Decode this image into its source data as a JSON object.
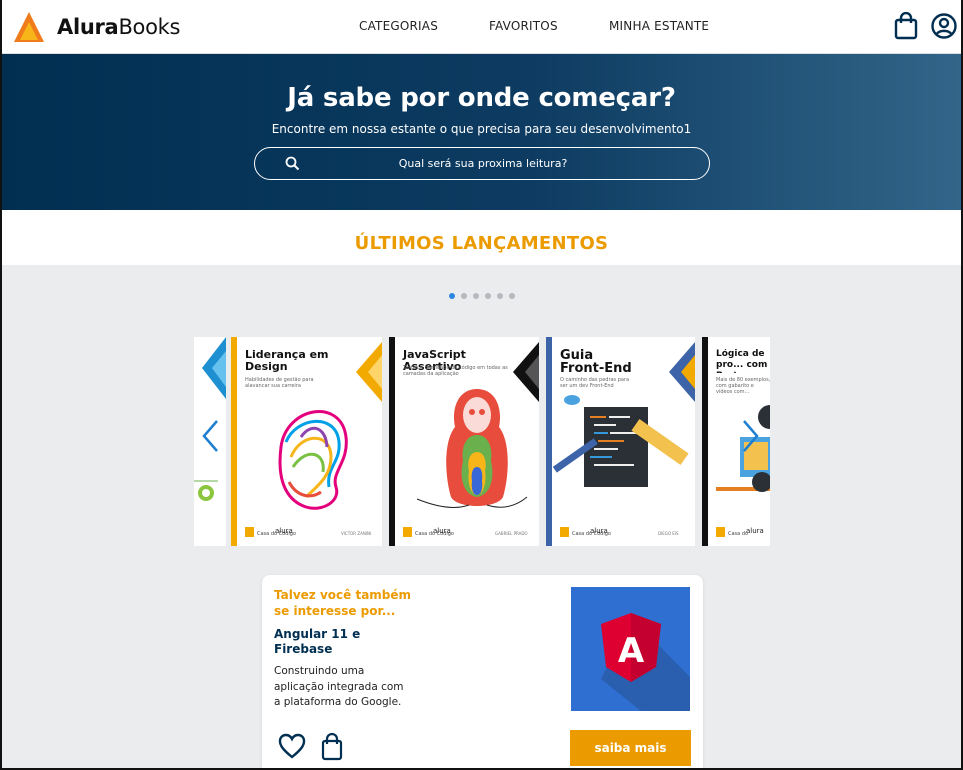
{
  "brand": {
    "name_bold": "Alura",
    "name_regular": "Books",
    "accent": "#eb9b00",
    "dark": "#002f52"
  },
  "nav": {
    "items": [
      "CATEGORIAS",
      "FAVORITOS",
      "MINHA ESTANTE"
    ]
  },
  "header_icons": [
    "shopping-bag-icon",
    "user-icon"
  ],
  "hero": {
    "title": "Já sabe por onde começar?",
    "subtitle": "Encontre em nossa estante o que precisa para seu desenvolvimento1",
    "search_placeholder": "Qual será sua proxima leitura?"
  },
  "section": {
    "title": "ÚLTIMOS LANÇAMENTOS"
  },
  "carousel": {
    "active_index": 0,
    "dot_count": 6,
    "books": [
      {
        "title": "Liderança em Design",
        "subtitle": "Habilidades de gestão para alavancar sua carreira",
        "publisher": "alura"
      },
      {
        "title": "JavaScript Assertivo",
        "subtitle": "Testes e qualidade de código em todas as camadas da aplicação",
        "publisher": "alura"
      },
      {
        "title": "Guia Front-End",
        "subtitle": "O caminho das pedras para ser um dev Front-End",
        "publisher": "alura"
      },
      {
        "title": "Lógica de pro... com Portugu...",
        "subtitle": "Mais de 80 exemplos, com gabarito e vídeos com...",
        "publisher": "alura"
      }
    ]
  },
  "recommendation": {
    "heading": "Talvez você também se interesse por...",
    "title": "Angular 11 e Firebase",
    "description": "Construindo uma aplicação integrada com a plataforma do Google.",
    "button": "saiba mais",
    "cover_letter": "A"
  }
}
